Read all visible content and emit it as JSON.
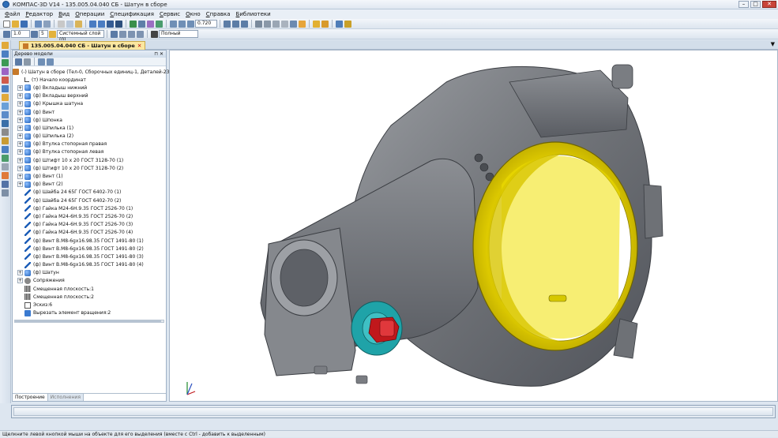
{
  "window": {
    "title": "КОМПАС-3D V14 - 135.005.04.040 СБ - Шатун в сборе"
  },
  "menu": [
    "Файл",
    "Редактор",
    "Вид",
    "Операции",
    "Спецификация",
    "Сервис",
    "Окно",
    "Справка",
    "Библиотеки"
  ],
  "toolbar2": {
    "scale": "1.0",
    "step": "5",
    "layer": "Системный слой (0)",
    "style": "Полный"
  },
  "toolbar1": {
    "zoom": "0.720"
  },
  "document_tab": {
    "label": "135.005.04.040 СБ - Шатун в сборе"
  },
  "tree_panel": {
    "title": "Дерево модели",
    "root": "(-) Шатун в сборе (Тел-0, Сборочных единиц-1, Деталей-23)",
    "items": [
      {
        "label": "(т) Начало координат",
        "icon": "origin-icon",
        "expandable": false
      },
      {
        "label": "(ф) Вкладыш нижний",
        "icon": "part-icon",
        "expandable": true
      },
      {
        "label": "(ф) Вкладыш верхний",
        "icon": "part-icon",
        "expandable": true
      },
      {
        "label": "(ф) Крышка шатуна",
        "icon": "part-icon",
        "expandable": true
      },
      {
        "label": "(ф) Винт",
        "icon": "part-icon",
        "expandable": true
      },
      {
        "label": "(ф) Шпонка",
        "icon": "part-icon",
        "expandable": true
      },
      {
        "label": "(ф) Шпилька (1)",
        "icon": "part-icon",
        "expandable": true
      },
      {
        "label": "(ф) Шпилька (2)",
        "icon": "part-icon",
        "expandable": true
      },
      {
        "label": "(ф) Втулка стопорная правая",
        "icon": "part-icon",
        "expandable": true
      },
      {
        "label": "(ф) Втулка стопорная левая",
        "icon": "part-icon",
        "expandable": true
      },
      {
        "label": "(ф) Штифт 10 х 20 ГОСТ 3128-70 (1)",
        "icon": "part-icon",
        "expandable": true
      },
      {
        "label": "(ф) Штифт 10 х 20 ГОСТ 3128-70 (2)",
        "icon": "part-icon",
        "expandable": true
      },
      {
        "label": "(ф) Винт (1)",
        "icon": "part-icon",
        "expandable": true
      },
      {
        "label": "(ф) Винт (2)",
        "icon": "part-icon",
        "expandable": true
      },
      {
        "label": "(ф) Шайба 24 65Г ГОСТ 6402-70 (1)",
        "icon": "standard-part-icon",
        "expandable": false
      },
      {
        "label": "(ф) Шайба 24 65Г ГОСТ 6402-70 (2)",
        "icon": "standard-part-icon",
        "expandable": false
      },
      {
        "label": "(ф) Гайка  М24-6Н.9.35 ГОСТ 2526-70 (1)",
        "icon": "standard-part-icon",
        "expandable": false
      },
      {
        "label": "(ф) Гайка  М24-6Н.9.35 ГОСТ 2526-70 (2)",
        "icon": "standard-part-icon",
        "expandable": false
      },
      {
        "label": "(ф) Гайка  М24-6Н.9.35 ГОСТ 2526-70 (3)",
        "icon": "standard-part-icon",
        "expandable": false
      },
      {
        "label": "(ф) Гайка  М24-6Н.9.35 ГОСТ 2526-70 (4)",
        "icon": "standard-part-icon",
        "expandable": false
      },
      {
        "label": "(ф) Винт В.М8-6gх16.98.35 ГОСТ 1491-80 (1)",
        "icon": "standard-part-icon",
        "expandable": false
      },
      {
        "label": "(ф) Винт В.М8-6gх16.98.35 ГОСТ 1491-80 (2)",
        "icon": "standard-part-icon",
        "expandable": false
      },
      {
        "label": "(ф) Винт В.М8-6gх16.98.35 ГОСТ 1491-80 (3)",
        "icon": "standard-part-icon",
        "expandable": false
      },
      {
        "label": "(ф) Винт В.М8-6gх16.98.35 ГОСТ 1491-80 (4)",
        "icon": "standard-part-icon",
        "expandable": false
      },
      {
        "label": "(ф) Шатун",
        "icon": "part-icon",
        "expandable": true
      },
      {
        "label": "Сопряжения",
        "icon": "mates-icon",
        "expandable": true
      },
      {
        "label": "Смещенная плоскость:1",
        "icon": "plane-icon",
        "expandable": false
      },
      {
        "label": "Смещенная плоскость:2",
        "icon": "plane-icon",
        "expandable": false
      },
      {
        "label": "Эскиз:6",
        "icon": "sketch-icon",
        "expandable": false
      },
      {
        "label": "Вырезать элемент вращения:2",
        "icon": "feature-icon",
        "expandable": false
      }
    ],
    "tabs": [
      "Построение",
      "Исполнения"
    ]
  },
  "status": {
    "hint": "Щелкните левой кнопкой мыши на объекте для его выделения (вместе с Ctrl - добавить к выделенным)"
  },
  "colors": {
    "bearing": "#e8d400",
    "body": "#7c7f84",
    "accent_tab": "#fbe7a0",
    "nut": "#c0181c",
    "washer": "#1fa3a8"
  }
}
